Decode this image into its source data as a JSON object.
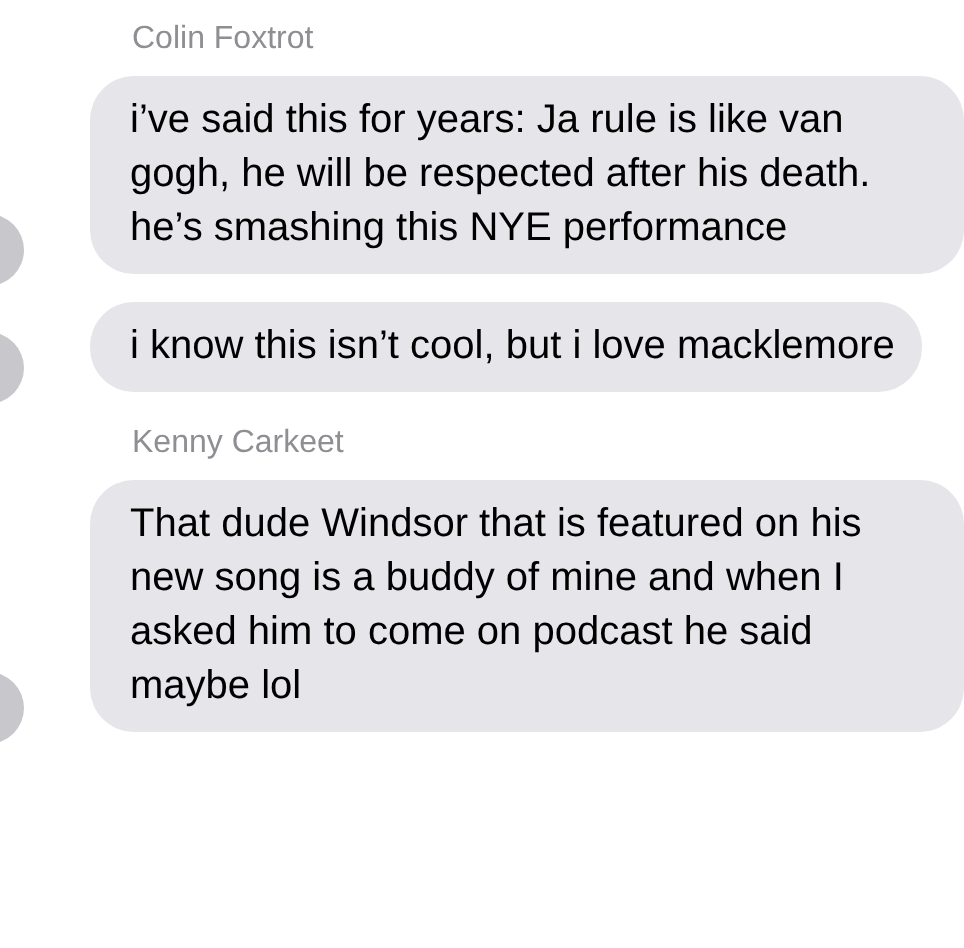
{
  "messages": [
    {
      "sender": "Colin Foxtrot",
      "text": "i’ve said this for years: Ja rule is like van gogh, he will be respected after his death. he’s smashing this NYE performance"
    },
    {
      "text": "i know this isn’t cool, but i love macklemore"
    },
    {
      "sender": "Kenny Carkeet",
      "text": "That dude Windsor that is featured on his new song is a buddy of mine and when I asked him to come on podcast he said maybe lol"
    }
  ]
}
